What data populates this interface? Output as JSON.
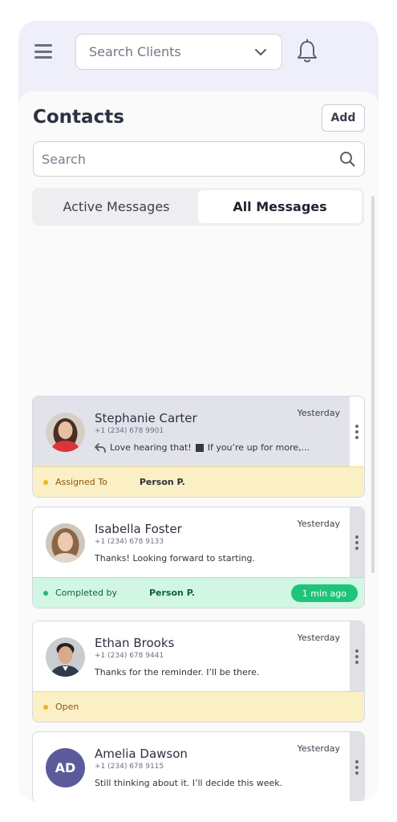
{
  "header": {
    "client_select_value": "Search Clients"
  },
  "contacts": {
    "title": "Contacts",
    "add_label": "Add",
    "search_placeholder": "Search",
    "tabs": [
      {
        "label": "Active Messages",
        "active": false
      },
      {
        "label": "All Messages",
        "active": true
      }
    ],
    "items": [
      {
        "name": "Stephanie Carter",
        "phone": "+1 (234) 678 9901",
        "preview": "Love hearing that! ⬛ If you’re up for more,...",
        "preview_part1": "Love hearing that!",
        "preview_part2": "If you’re up for more,...",
        "time": "Yesterday",
        "status_label": "Assigned To",
        "status_person": "Person P.",
        "status_type": "yellow"
      },
      {
        "name": "Isabella Foster",
        "phone": "+1 (234) 678 9133",
        "preview": "Thanks! Looking forward to starting.",
        "time": "Yesterday",
        "status_label": "Completed by",
        "status_person": "Person P.",
        "status_badge": "1 min ago",
        "status_type": "green"
      },
      {
        "name": "Ethan Brooks",
        "phone": "+1 (234) 678 9441",
        "preview": "Thanks for the reminder. I’ll be there.",
        "time": "Yesterday",
        "status_label": "Open",
        "status_type": "yellow"
      },
      {
        "name": "Amelia Dawson",
        "initials": "AD",
        "phone": "+1 (234) 678 9115",
        "preview": "Still thinking about it. I’ll decide this week.",
        "time": "Yesterday"
      }
    ]
  },
  "colors": {
    "header_bg": "#efeffa",
    "selected_card_bg": "#e2e2ea",
    "assigned_bg": "#fbefc6",
    "completed_bg": "#d1f6e3",
    "completed_pill": "#1fc47a",
    "initials_avatar": "#5b5b9c"
  }
}
